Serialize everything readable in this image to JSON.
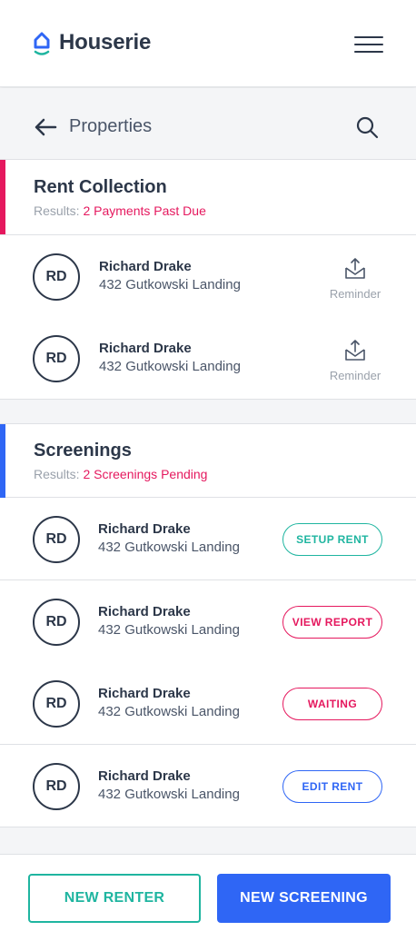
{
  "app": {
    "brand": "Houserie",
    "colors": {
      "accent_pink": "#e5185e",
      "accent_blue": "#2f66f5",
      "accent_teal": "#1fb5a0",
      "text_dark": "#2c3749"
    }
  },
  "header": {
    "menu_icon": "hamburger-menu-icon"
  },
  "subheader": {
    "back_icon": "arrow-left-icon",
    "title": "Properties",
    "search_icon": "search-icon"
  },
  "rent_collection": {
    "title": "Rent Collection",
    "results_label": "Results:",
    "results_value": "2 Payments Past Due",
    "items": [
      {
        "initials": "RD",
        "name": "Richard Drake",
        "address": "432 Gutkowski Landing",
        "action": "Reminder"
      },
      {
        "initials": "RD",
        "name": "Richard Drake",
        "address": "432 Gutkowski Landing",
        "action": "Reminder"
      }
    ]
  },
  "screenings": {
    "title": "Screenings",
    "results_label": "Results:",
    "results_value": "2 Screenings Pending",
    "items": [
      {
        "initials": "RD",
        "name": "Richard Drake",
        "address": "432 Gutkowski Landing",
        "action": "SETUP RENT",
        "action_color": "#1fb5a0"
      },
      {
        "initials": "RD",
        "name": "Richard Drake",
        "address": "432 Gutkowski Landing",
        "action": "VIEW REPORT",
        "action_color": "#e5185e"
      },
      {
        "initials": "RD",
        "name": "Richard Drake",
        "address": "432 Gutkowski Landing",
        "action": "WAITING",
        "action_color": "#e5185e"
      },
      {
        "initials": "RD",
        "name": "Richard Drake",
        "address": "432 Gutkowski Landing",
        "action": "EDIT RENT",
        "action_color": "#2f66f5"
      }
    ]
  },
  "footer": {
    "new_renter": "NEW RENTER",
    "new_screening": "NEW SCREENING"
  }
}
